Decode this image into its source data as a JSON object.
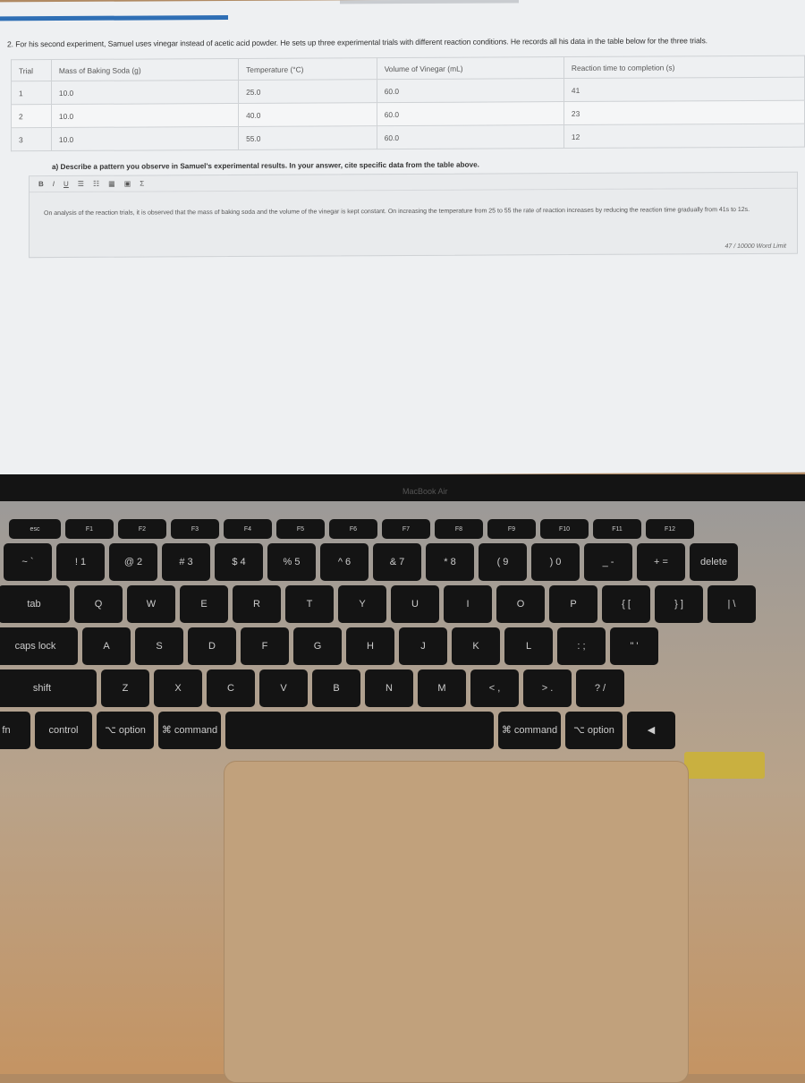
{
  "question": "2. For his second experiment, Samuel uses vinegar instead of acetic acid powder. He sets up three experimental trials with different reaction conditions. He records all his data in the table below for the three trials.",
  "table": {
    "headers": [
      "Trial",
      "Mass of Baking Soda (g)",
      "Temperature (°C)",
      "Volume of Vinegar (mL)",
      "Reaction time to completion (s)"
    ],
    "rows": [
      [
        "1",
        "10.0",
        "25.0",
        "60.0",
        "41"
      ],
      [
        "2",
        "10.0",
        "40.0",
        "60.0",
        "23"
      ],
      [
        "3",
        "10.0",
        "55.0",
        "60.0",
        "12"
      ]
    ]
  },
  "subquestion": "a) Describe a pattern you observe in Samuel's experimental results. In your answer, cite specific data from the table above.",
  "toolbar": {
    "bold": "B",
    "italic": "I",
    "underline": "U",
    "bullets": "☰",
    "numbered": "☷",
    "table": "▦",
    "image": "▣",
    "formula": "Σ"
  },
  "answer": "On analysis of the reaction trials, it is observed that the mass of baking soda and the volume of the vinegar is kept constant. On increasing the temperature from 25 to 55 the rate of reaction increases by reducing the reaction time gradually from 41s to 12s.",
  "word_count": "47 / 10000 Word Limit",
  "brand": "MacBook Air",
  "keyboard": {
    "fn": [
      "esc",
      "F1",
      "F2",
      "F3",
      "F4",
      "F5",
      "F6",
      "F7",
      "F8",
      "F9",
      "F10",
      "F11",
      "F12"
    ],
    "r1": [
      "~ `",
      "! 1",
      "@ 2",
      "# 3",
      "$ 4",
      "% 5",
      "^ 6",
      "& 7",
      "* 8",
      "( 9",
      ") 0",
      "_ -",
      "+ =",
      "delete"
    ],
    "r2": [
      "tab",
      "Q",
      "W",
      "E",
      "R",
      "T",
      "Y",
      "U",
      "I",
      "O",
      "P",
      "{ [",
      "} ]",
      "| \\"
    ],
    "r3": [
      "caps lock",
      "A",
      "S",
      "D",
      "F",
      "G",
      "H",
      "J",
      "K",
      "L",
      ": ;",
      "\" '"
    ],
    "r4": [
      "shift",
      "Z",
      "X",
      "C",
      "V",
      "B",
      "N",
      "M",
      "< ,",
      "> .",
      "? /"
    ],
    "r5": [
      "fn",
      "control",
      "⌥ option",
      "⌘ command",
      "",
      "⌘ command",
      "⌥ option",
      "◀"
    ]
  }
}
